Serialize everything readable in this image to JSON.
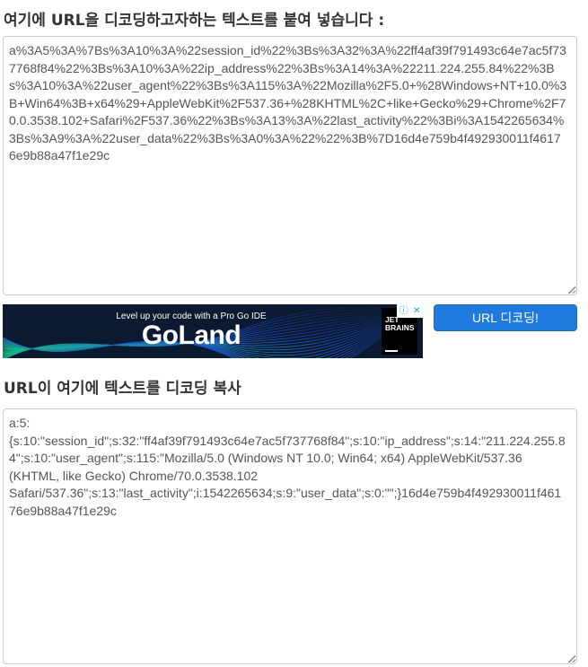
{
  "input_section": {
    "heading": "여기에 URL을 디코딩하고자하는 텍스트를 붙여 넣습니다 :",
    "value": "a%3A5%3A%7Bs%3A10%3A%22session_id%22%3Bs%3A32%3A%22ff4af39f791493c64e7ac5f737768f84%22%3Bs%3A10%3A%22ip_address%22%3Bs%3A14%3A%22211.224.255.84%22%3Bs%3A10%3A%22user_agent%22%3Bs%3A115%3A%22Mozilla%2F5.0+%28Windows+NT+10.0%3B+Win64%3B+x64%29+AppleWebKit%2F537.36+%28KHTML%2C+like+Gecko%29+Chrome%2F70.0.3538.102+Safari%2F537.36%22%3Bs%3A13%3A%22last_activity%22%3Bi%3A1542265634%3Bs%3A9%3A%22user_data%22%3Bs%3A0%3A%22%22%3B%7D16d4e759b4f492930011f46176e9b88a47f1e29c"
  },
  "ad": {
    "tagline": "Level up your code with a Pro Go IDE",
    "brand": "GoLand",
    "logo_line1": "JET",
    "logo_line2": "BRAINS",
    "choices_icon": "info-icon",
    "close_icon": "close-icon",
    "choices_glyph": "ⓘ",
    "close_glyph": "✕"
  },
  "decode_button": {
    "label": "URL 디코딩!",
    "color": "#1f7ae0"
  },
  "output_section": {
    "heading": "URL이 여기에 텍스트를 디코딩 복사",
    "value": "a:5:\n{s:10:\"session_id\";s:32:\"ff4af39f791493c64e7ac5f737768f84\";s:10:\"ip_address\";s:14:\"211.224.255.84\";s:10:\"user_agent\";s:115:\"Mozilla/5.0 (Windows NT 10.0; Win64; x64) AppleWebKit/537.36\n(KHTML, like Gecko) Chrome/70.0.3538.102\nSafari/537.36\";s:13:\"last_activity\";i:1542265634;s:9:\"user_data\";s:0:\"\";}16d4e759b4f492930011f46176e9b88a47f1e29c"
  }
}
